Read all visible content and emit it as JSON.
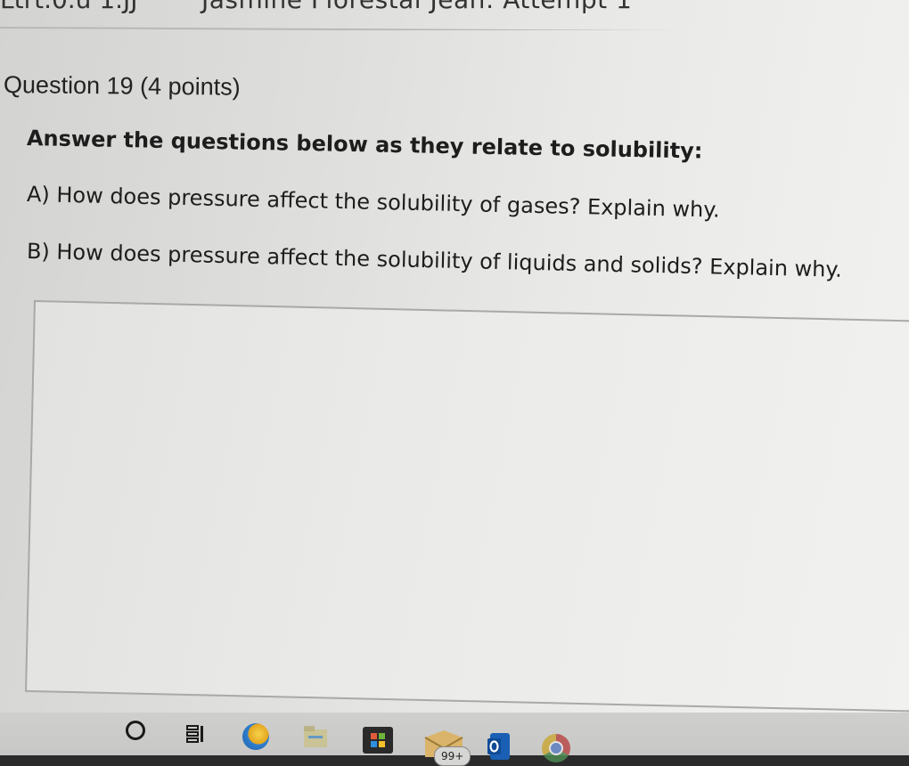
{
  "header": {
    "left_stub": "Ltrt.0.u 1.JJ",
    "title": "Jasmine Florestal Jean: Attempt 1"
  },
  "question": {
    "heading": "Question 19",
    "points": "(4 points)",
    "prompt": "Answer the questions below as they relate to solubility:",
    "part_a": "A) How does pressure affect the solubility of gases? Explain why.",
    "part_b": "B) How does pressure affect the solubility of liquids and solids? Explain why."
  },
  "answer": {
    "value": "",
    "placeholder": ""
  },
  "taskbar": {
    "icons": [
      "cortana-icon",
      "task-view-icon",
      "edge-icon",
      "file-explorer-icon",
      "store-icon",
      "mail-icon",
      "outlook-icon",
      "chrome-icon"
    ],
    "mail_badge": "99+"
  }
}
